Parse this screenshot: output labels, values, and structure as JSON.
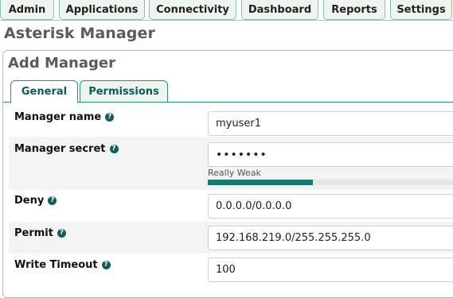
{
  "nav": {
    "tabs": [
      {
        "label": "Admin"
      },
      {
        "label": "Applications"
      },
      {
        "label": "Connectivity"
      },
      {
        "label": "Dashboard"
      },
      {
        "label": "Reports"
      },
      {
        "label": "Settings"
      }
    ]
  },
  "page": {
    "title": "Asterisk Manager"
  },
  "form": {
    "title": "Add Manager",
    "tabs": [
      {
        "label": "General",
        "active": true
      },
      {
        "label": "Permissions",
        "active": false
      }
    ],
    "fields": {
      "manager_name": {
        "label": "Manager name",
        "value": "myuser1"
      },
      "manager_secret": {
        "label": "Manager secret",
        "value": "•••••••",
        "strength_text": "Really Weak",
        "strength_fraction": 0.4
      },
      "deny": {
        "label": "Deny",
        "value": "0.0.0.0/0.0.0.0"
      },
      "permit": {
        "label": "Permit",
        "value": "192.168.219.0/255.255.255.0"
      },
      "write_timeout": {
        "label": "Write Timeout",
        "value": "100"
      }
    },
    "help_icon": "question-circle-icon"
  },
  "colors": {
    "accent": "#157a71",
    "tab_border": "#2a8c82",
    "help_icon": "#0f5f5a"
  }
}
